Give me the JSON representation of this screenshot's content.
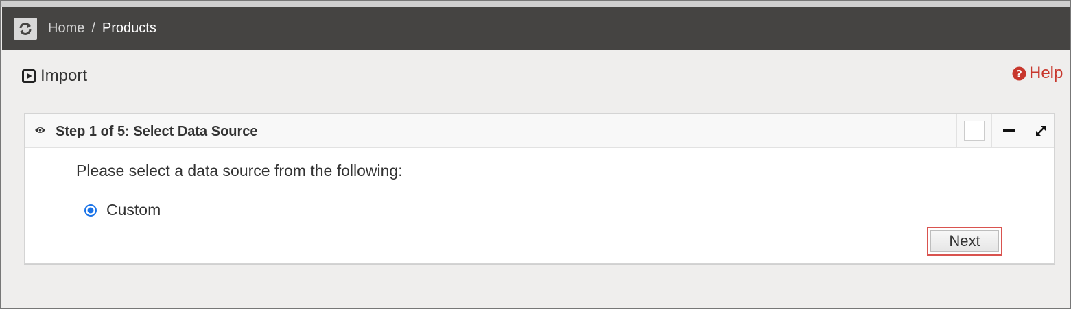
{
  "navbar": {
    "refresh_icon": "refresh-icon",
    "breadcrumb": {
      "home": "Home",
      "separator": "/",
      "current": "Products"
    }
  },
  "page": {
    "title": "Import",
    "title_icon": "play-square-icon",
    "help_label": "Help",
    "help_icon": "question-circle-icon",
    "help_color": "#c8372d"
  },
  "panel": {
    "title": "Step 1 of 5: Select Data Source",
    "title_icon": "eye-icon",
    "header_buttons": [
      "blank-box",
      "minimize-icon",
      "expand-icon"
    ],
    "prompt": "Please select a data source from the following:",
    "options": [
      {
        "label": "Custom",
        "selected": true
      }
    ],
    "next_label": "Next"
  },
  "colors": {
    "navbar_bg": "#454442",
    "accent_radio": "#1a73e8",
    "highlight_border": "#d9534f"
  }
}
